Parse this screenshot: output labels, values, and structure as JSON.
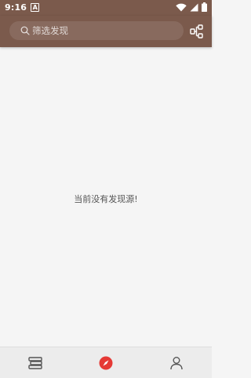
{
  "status_bar": {
    "time": "9:16",
    "notification_letter": "A"
  },
  "toolbar": {
    "search_placeholder": "筛选发现"
  },
  "main": {
    "empty_message": "当前没有发现源!"
  },
  "bottom_nav": {
    "items": [
      {
        "icon": "bookshelf-icon",
        "active": false
      },
      {
        "icon": "compass-icon",
        "active": true
      },
      {
        "icon": "person-icon",
        "active": false
      }
    ]
  },
  "colors": {
    "primary": "#7b5a4c",
    "accent": "#e53935",
    "background": "#f5f5f5",
    "nav_background": "#ececec"
  }
}
